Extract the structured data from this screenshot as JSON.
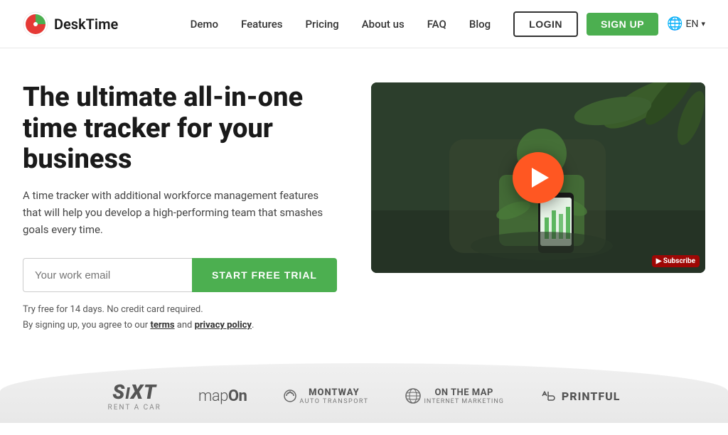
{
  "header": {
    "logo_text": "DeskTime",
    "nav": {
      "items": [
        {
          "label": "Demo",
          "id": "demo"
        },
        {
          "label": "Features",
          "id": "features"
        },
        {
          "label": "Pricing",
          "id": "pricing"
        },
        {
          "label": "About us",
          "id": "about"
        },
        {
          "label": "FAQ",
          "id": "faq"
        },
        {
          "label": "Blog",
          "id": "blog"
        }
      ]
    },
    "login_label": "LOGIN",
    "signup_label": "SIGN UP",
    "lang_label": "EN"
  },
  "hero": {
    "title": "The ultimate all-in-one time tracker for your business",
    "subtitle": "A time tracker with additional workforce management features that will help you develop a high-performing team that smashes goals every time.",
    "email_placeholder": "Your work email",
    "cta_button": "START FREE TRIAL",
    "fine_print_line1": "Try free for 14 days. No credit card required.",
    "fine_print_line2": "By signing up, you agree to our ",
    "terms_label": "terms",
    "and_text": " and ",
    "privacy_label": "privacy policy",
    "fine_print_end": "."
  },
  "brands": {
    "items": [
      {
        "name": "SIXT",
        "sub": "rent a car",
        "id": "sixt"
      },
      {
        "name": "mapOn",
        "id": "mapon"
      },
      {
        "name": "MONTWAY\nAUTO TRANSPORT",
        "id": "montway"
      },
      {
        "name": "ON THE MAP\nINTERNET MARKETING",
        "id": "onthemap"
      },
      {
        "name": "PRINTFUL",
        "id": "printful"
      }
    ]
  }
}
